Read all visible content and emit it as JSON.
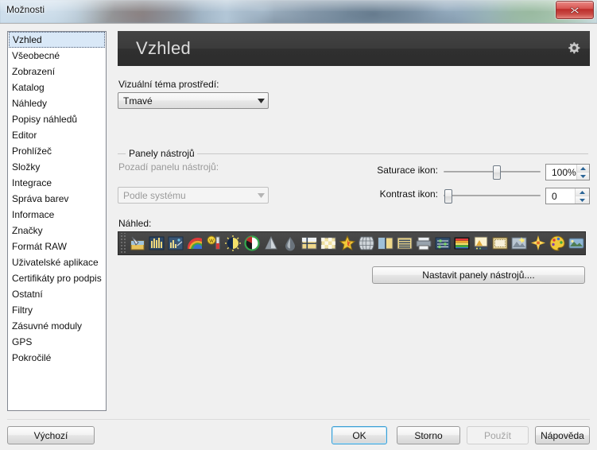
{
  "window": {
    "title": "Možnosti",
    "close_label": "x"
  },
  "sidebar": {
    "items": [
      {
        "label": "Vzhled",
        "selected": true
      },
      {
        "label": "Všeobecné",
        "selected": false
      },
      {
        "label": "Zobrazení",
        "selected": false
      },
      {
        "label": "Katalog",
        "selected": false
      },
      {
        "label": "Náhledy",
        "selected": false
      },
      {
        "label": "Popisy náhledů",
        "selected": false
      },
      {
        "label": "Editor",
        "selected": false
      },
      {
        "label": "Prohlížeč",
        "selected": false
      },
      {
        "label": "Složky",
        "selected": false
      },
      {
        "label": "Integrace",
        "selected": false
      },
      {
        "label": "Správa barev",
        "selected": false
      },
      {
        "label": "Informace",
        "selected": false
      },
      {
        "label": "Značky",
        "selected": false
      },
      {
        "label": "Formát RAW",
        "selected": false
      },
      {
        "label": "Uživatelské aplikace",
        "selected": false
      },
      {
        "label": "Certifikáty pro podpis",
        "selected": false
      },
      {
        "label": "Ostatní",
        "selected": false
      },
      {
        "label": "Filtry",
        "selected": false
      },
      {
        "label": "Zásuvné moduly",
        "selected": false
      },
      {
        "label": "GPS",
        "selected": false
      },
      {
        "label": "Pokročilé",
        "selected": false
      }
    ]
  },
  "panel": {
    "header_title": "Vzhled",
    "gear_icon": "gear-icon",
    "theme": {
      "label": "Vizuální téma prostředí:",
      "value": "Tmavé"
    },
    "group": {
      "title": "Panely nástrojů"
    },
    "toolbar_bg": {
      "label": "Pozadí panelu nástrojů:",
      "value": "Podle systému",
      "disabled": true
    },
    "saturation": {
      "label": "Saturace ikon:",
      "value": "100%",
      "slider_percent": 54
    },
    "contrast": {
      "label": "Kontrast ikon:",
      "value": "0",
      "slider_percent": 1
    },
    "preview": {
      "label": "Náhled:"
    },
    "configure_button": "Nastavit panely nástrojů...."
  },
  "footer": {
    "defaults": "Výchozí",
    "ok": "OK",
    "cancel": "Storno",
    "apply": "Použít",
    "help": "Nápověda"
  },
  "colors": {
    "header_bg": "#3b3b3b",
    "header_text": "#dcdcdc",
    "selection": "#d9e8f7",
    "default_button_border": "#3c9fd4",
    "close_button": "#c62f2b",
    "dialog_bg": "#f0f0f0",
    "toolbar_bg": "#434343"
  }
}
